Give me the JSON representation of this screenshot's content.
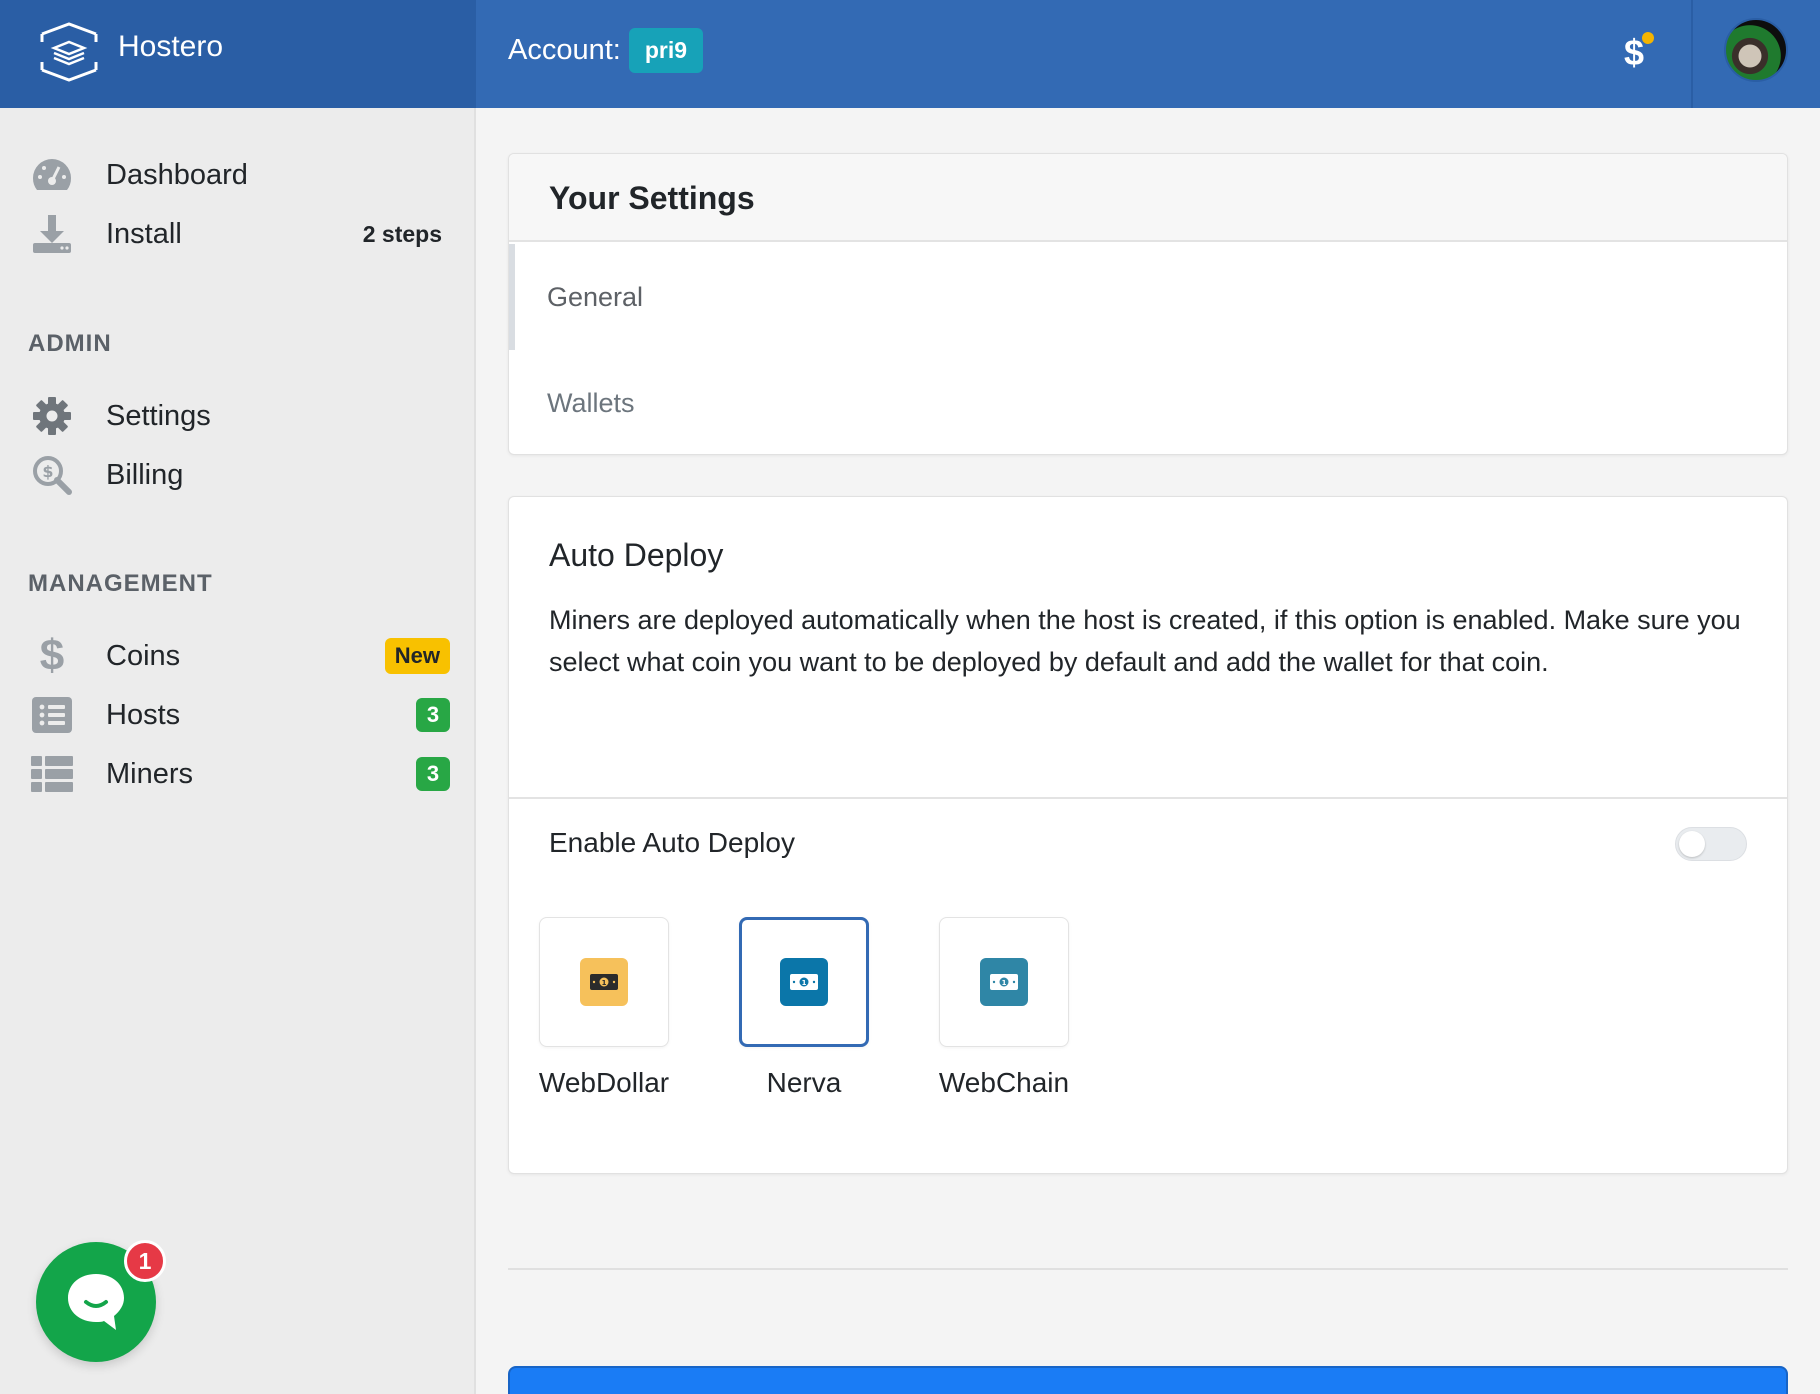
{
  "app": {
    "name": "Hostero"
  },
  "header": {
    "account_label": "Account:",
    "account_name": "pri9",
    "billing_icon": "dollar-icon",
    "avatar": "user-avatar"
  },
  "sidebar": {
    "main_items": [
      {
        "label": "Dashboard",
        "icon": "dashboard-gauge-icon"
      },
      {
        "label": "Install",
        "icon": "download-icon",
        "meta": "2 steps"
      }
    ],
    "admin_heading": "ADMIN",
    "admin_items": [
      {
        "label": "Settings",
        "icon": "gear-icon"
      },
      {
        "label": "Billing",
        "icon": "search-dollar-icon"
      }
    ],
    "management_heading": "MANAGEMENT",
    "management_items": [
      {
        "label": "Coins",
        "icon": "dollar-icon",
        "badge": "New"
      },
      {
        "label": "Hosts",
        "icon": "list-icon",
        "badge": "3"
      },
      {
        "label": "Miners",
        "icon": "table-list-icon",
        "badge": "3"
      }
    ]
  },
  "settings": {
    "title": "Your Settings",
    "tabs": [
      {
        "label": "General",
        "active": true
      },
      {
        "label": "Wallets",
        "active": false
      }
    ]
  },
  "auto_deploy": {
    "title": "Auto Deploy",
    "description": "Miners are deployed automatically when the host is created, if this option is enabled. Make sure you select what coin you want to be deployed by default and add the wallet for that coin.",
    "toggle_label": "Enable Auto Deploy",
    "toggle_on": false,
    "coins": [
      {
        "name": "WebDollar",
        "color": "#f6c15b",
        "selected": false
      },
      {
        "name": "Nerva",
        "color": "#0b76a9",
        "selected": true
      },
      {
        "name": "WebChain",
        "color": "#2f86a6",
        "selected": false
      }
    ]
  },
  "chat": {
    "unread": "1"
  },
  "colors": {
    "topbar": "#336ab4",
    "brand": "#2a5ea5",
    "account_badge": "#17a2b8",
    "badge_new": "#f8c100",
    "badge_count": "#28a745",
    "chat": "#13a54a",
    "primary": "#1a7cf5"
  }
}
